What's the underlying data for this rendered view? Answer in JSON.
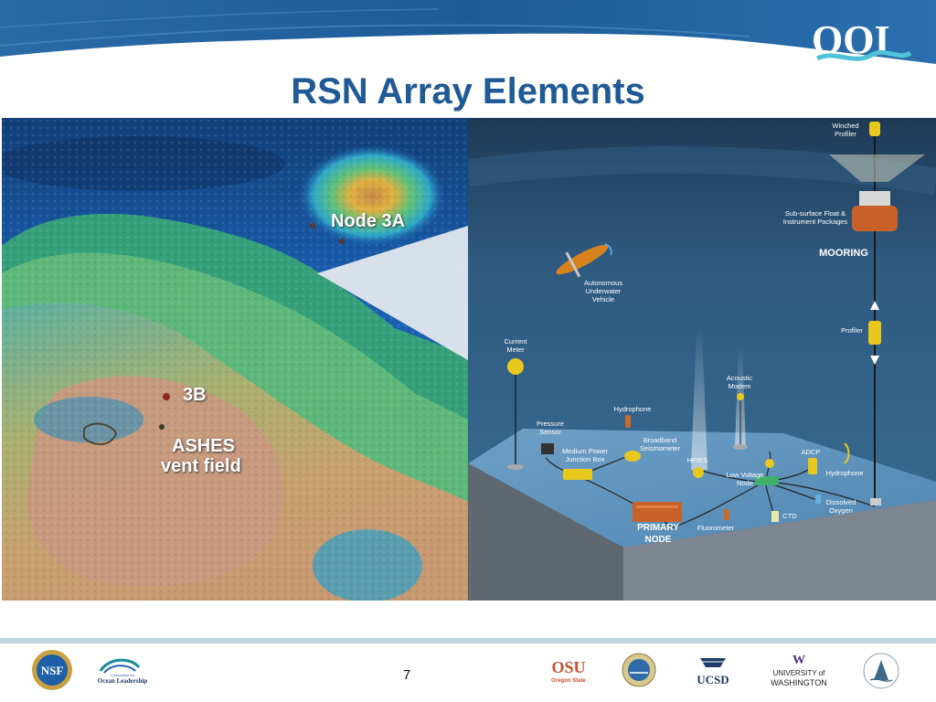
{
  "slide": {
    "title": "RSN Array Elements",
    "page_number": "7"
  },
  "header": {
    "logo_text": "OOI"
  },
  "map_labels": {
    "node3a": "Node 3A",
    "node3b": "3B",
    "ashes_line1": "ASHES",
    "ashes_line2": "vent field"
  },
  "diagram_labels": {
    "winched_profiler": [
      "Winched",
      "Profiler"
    ],
    "subsurface_float": [
      "Sub-surface Float &",
      "Instrument Packages"
    ],
    "mooring": "MOORING",
    "auv": [
      "Autonomous",
      "Underwater",
      "Vehicle"
    ],
    "profiler": "Profiler",
    "current_meter": [
      "Current",
      "Meter"
    ],
    "acoustic_modem": [
      "Acoustic",
      "Modem"
    ],
    "hydrophone_top": "Hydrophone",
    "pressure_sensor": [
      "Pressure",
      "Sensor"
    ],
    "broadband_seismometer": [
      "Broadband",
      "Seismometer"
    ],
    "medium_power_jb": [
      "Medium Power",
      "Junction Box"
    ],
    "hpies": "HPIES",
    "adcp": "ADCP",
    "low_voltage_node": [
      "Low Voltage",
      "Node"
    ],
    "hydrophone_right": "Hydrophone",
    "dissolved_oxygen": [
      "Dissolved",
      "Oxygen"
    ],
    "ctd": "CTD",
    "fluorometer": "Fluorometer",
    "primary_node": [
      "PRIMARY",
      "NODE"
    ]
  },
  "footer": {
    "logos": [
      {
        "name": "nsf",
        "text": "NSF"
      },
      {
        "name": "ocean-leadership",
        "text1": "Consortium for",
        "text2": "Ocean Leadership"
      },
      {
        "name": "osu",
        "text1": "OSU",
        "text2": "Oregon State"
      },
      {
        "name": "whoi-seal",
        "text": ""
      },
      {
        "name": "ucsd",
        "text": "UCSD"
      },
      {
        "name": "uw",
        "text1": "UNIVERSITY of",
        "text2": "WASHINGTON"
      },
      {
        "name": "mbari-seal",
        "text": ""
      }
    ]
  },
  "colors": {
    "title": "#1f5a96",
    "header_blue": "#1e5e9a",
    "ocean_deep": "#2b5a80",
    "seafloor": "#8fb8d6",
    "instrument_yellow": "#e8c81c",
    "primary_node_orange": "#c8602a"
  }
}
